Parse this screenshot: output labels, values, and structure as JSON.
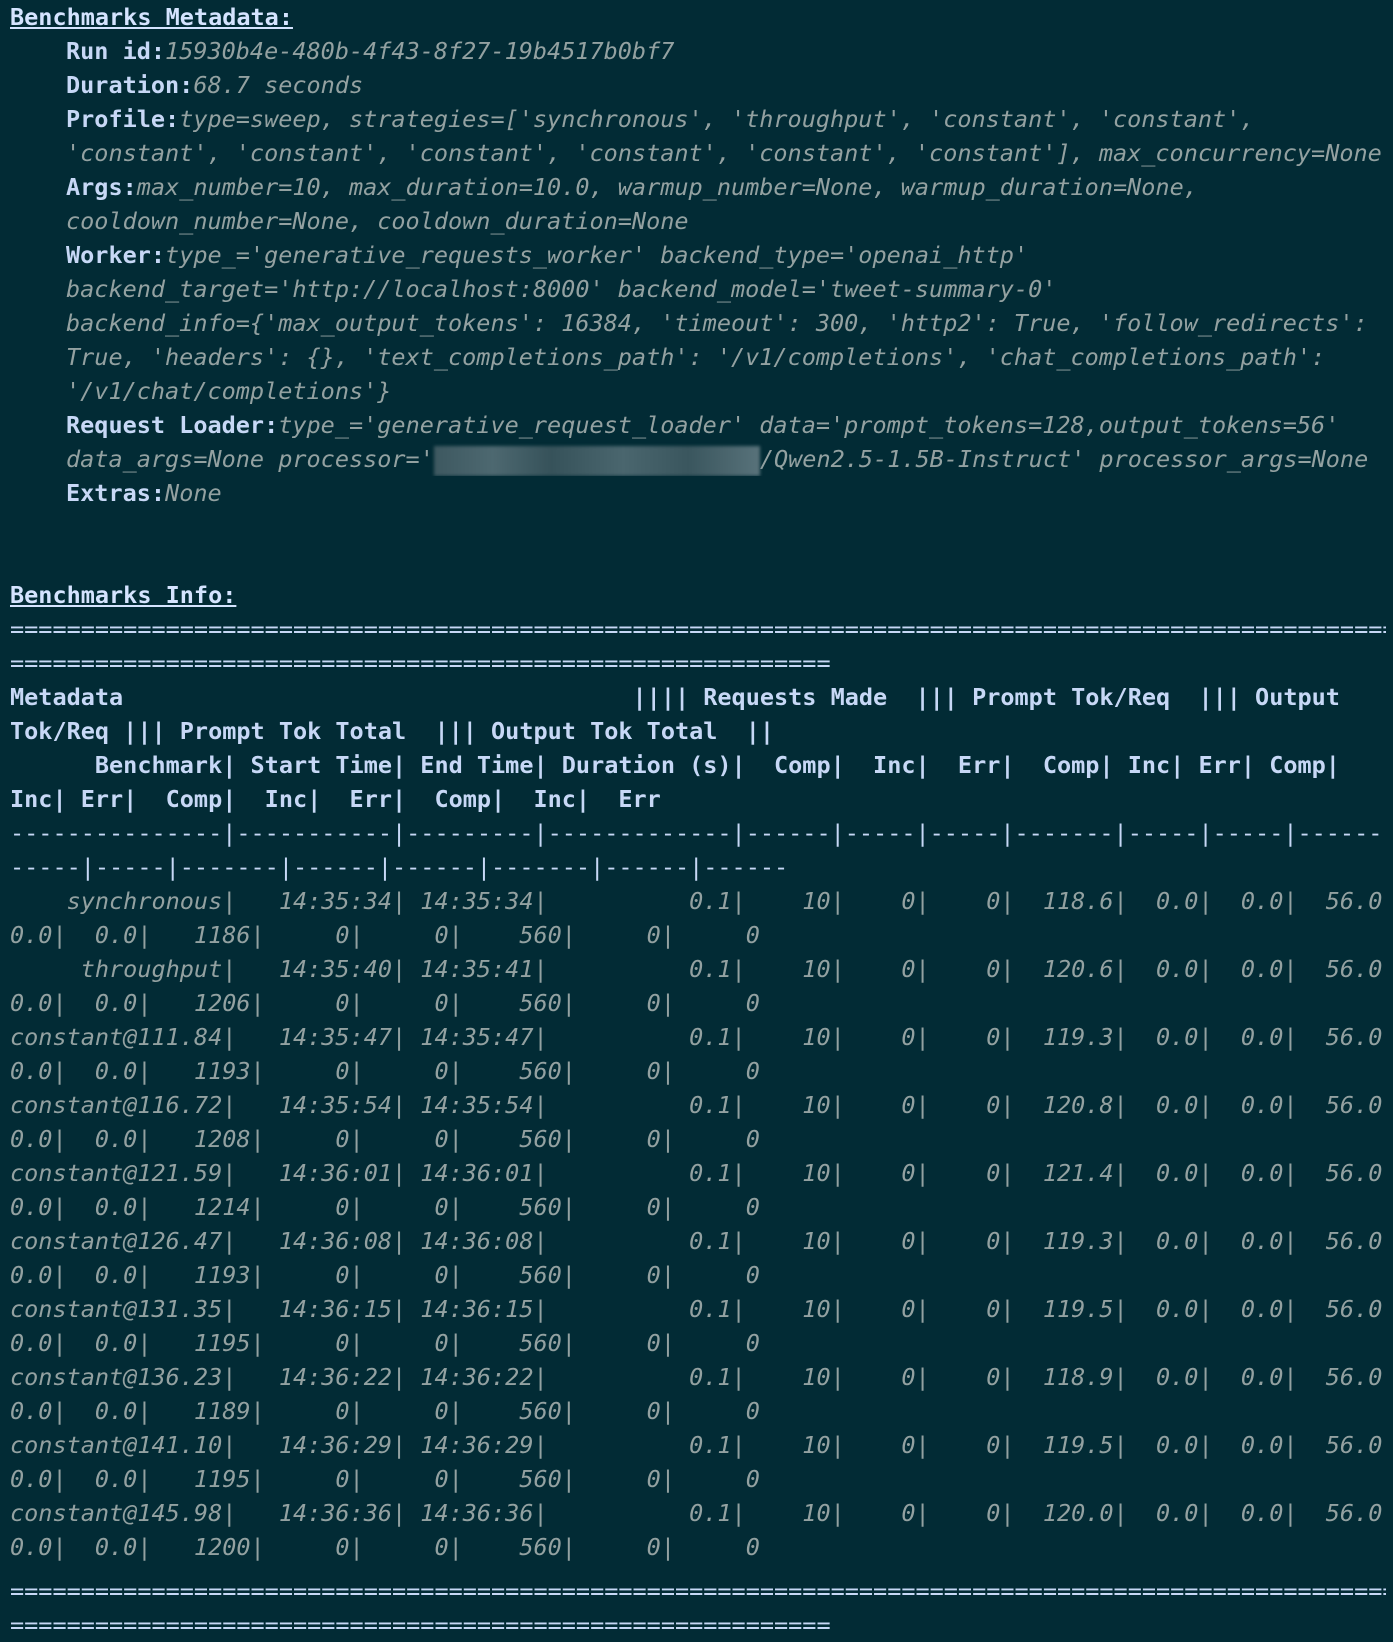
{
  "metadata": {
    "heading": "Benchmarks Metadata:",
    "run_id_key": "Run id:",
    "run_id": "15930b4e-480b-4f43-8f27-19b4517b0bf7",
    "duration_key": "Duration:",
    "duration": "68.7 seconds",
    "profile_key": "Profile:",
    "profile_1": "type=sweep, strategies=['synchronous', 'throughput', 'constant', 'constant',",
    "profile_2": "'constant', 'constant', 'constant', 'constant', 'constant', 'constant'], max_concurrency=None",
    "args_key": "Args:",
    "args_1": "max_number=10, max_duration=10.0, warmup_number=None, warmup_duration=None,",
    "args_2": "cooldown_number=None, cooldown_duration=None",
    "worker_key": "Worker:",
    "worker_1": "type_='generative_requests_worker' backend_type='openai_http'",
    "worker_2": "backend_target='http://localhost:8000' backend_model='tweet-summary-0'",
    "worker_3": "backend_info={'max_output_tokens': 16384, 'timeout': 300, 'http2': True, 'follow_redirects':",
    "worker_4": "True, 'headers': {}, 'text_completions_path': '/v1/completions', 'chat_completions_path':",
    "worker_5": "'/v1/chat/completions'}",
    "loader_key": "Request Loader:",
    "loader_1": "type_='generative_request_loader' data='prompt_tokens=128,output_tokens=56'",
    "loader_2a": "data_args=None processor='",
    "loader_2b": "/Qwen2.5-1.5B-Instruct' processor_args=None",
    "extras_key": "Extras:",
    "extras": "None"
  },
  "info": {
    "heading": "Benchmarks Info:",
    "rule_long": "==================================================================================================",
    "rule_short": "==========================================================",
    "header_1a": "Metadata                                    |||| Requests Made  ||| Prompt Tok/Req  ||| Output",
    "header_1b": "Tok/Req ||| Prompt Tok Total  ||| Output Tok Total  ||",
    "header_2a": "      Benchmark| Start Time| End Time| Duration (s)|  Comp|  Inc|  Err|  Comp| Inc| Err| Comp|",
    "header_2b": "Inc| Err|  Comp|  Inc|  Err|  Comp|  Inc|  Err",
    "sep_a": "---------------|-----------|---------|-------------|------|-----|-----|-------|-----|-----|------|",
    "sep_b": "-----|-----|-------|------|------|-------|------|------",
    "rows": [
      {
        "a": "    synchronous|   14:35:34| 14:35:34|          0.1|    10|    0|    0|  118.6|  0.0|  0.0|  56.0|",
        "b": "0.0|  0.0|   1186|     0|     0|    560|     0|     0"
      },
      {
        "a": "     throughput|   14:35:40| 14:35:41|          0.1|    10|    0|    0|  120.6|  0.0|  0.0|  56.0|",
        "b": "0.0|  0.0|   1206|     0|     0|    560|     0|     0"
      },
      {
        "a": "constant@111.84|   14:35:47| 14:35:47|          0.1|    10|    0|    0|  119.3|  0.0|  0.0|  56.0|",
        "b": "0.0|  0.0|   1193|     0|     0|    560|     0|     0"
      },
      {
        "a": "constant@116.72|   14:35:54| 14:35:54|          0.1|    10|    0|    0|  120.8|  0.0|  0.0|  56.0|",
        "b": "0.0|  0.0|   1208|     0|     0|    560|     0|     0"
      },
      {
        "a": "constant@121.59|   14:36:01| 14:36:01|          0.1|    10|    0|    0|  121.4|  0.0|  0.0|  56.0|",
        "b": "0.0|  0.0|   1214|     0|     0|    560|     0|     0"
      },
      {
        "a": "constant@126.47|   14:36:08| 14:36:08|          0.1|    10|    0|    0|  119.3|  0.0|  0.0|  56.0|",
        "b": "0.0|  0.0|   1193|     0|     0|    560|     0|     0"
      },
      {
        "a": "constant@131.35|   14:36:15| 14:36:15|          0.1|    10|    0|    0|  119.5|  0.0|  0.0|  56.0|",
        "b": "0.0|  0.0|   1195|     0|     0|    560|     0|     0"
      },
      {
        "a": "constant@136.23|   14:36:22| 14:36:22|          0.1|    10|    0|    0|  118.9|  0.0|  0.0|  56.0|",
        "b": "0.0|  0.0|   1189|     0|     0|    560|     0|     0"
      },
      {
        "a": "constant@141.10|   14:36:29| 14:36:29|          0.1|    10|    0|    0|  119.5|  0.0|  0.0|  56.0|",
        "b": "0.0|  0.0|   1195|     0|     0|    560|     0|     0"
      },
      {
        "a": "constant@145.98|   14:36:36| 14:36:36|          0.1|    10|    0|    0|  120.0|  0.0|  0.0|  56.0|",
        "b": "0.0|  0.0|   1200|     0|     0|    560|     0|     0"
      }
    ]
  }
}
